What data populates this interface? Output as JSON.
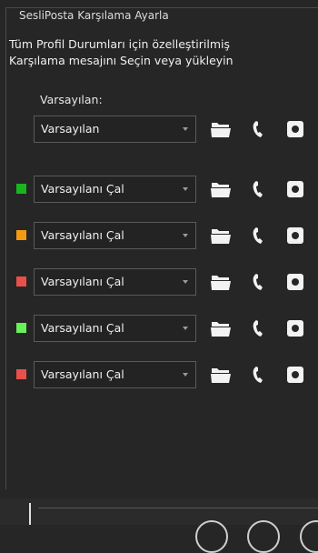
{
  "group": {
    "title": "SesliPosta Karşılama Ayarla",
    "desc_line1": "Tüm Profil Durumları için özelleştirilmiş",
    "desc_line2": "Karşılama mesajını Seçin veya yükleyin"
  },
  "default_section": {
    "label": "Varsayılan:",
    "combo_value": "Varsayılan"
  },
  "status_rows": [
    {
      "color": "#18b51f",
      "combo_value": "Varsayılanı Çal"
    },
    {
      "color": "#f39a12",
      "combo_value": "Varsayılanı Çal"
    },
    {
      "color": "#e8504a",
      "combo_value": "Varsayılanı Çal"
    },
    {
      "color": "#67f058",
      "combo_value": "Varsayılanı Çal"
    },
    {
      "color": "#e8504a",
      "combo_value": "Varsayılanı Çal"
    }
  ],
  "icons": {
    "folder": "folder-icon",
    "phone": "phone-icon",
    "record": "record-icon",
    "dropdown": "chevron-down-icon"
  },
  "colors": {
    "background": "#262626",
    "text": "#f0f0f0",
    "border": "#5a5a5a"
  }
}
